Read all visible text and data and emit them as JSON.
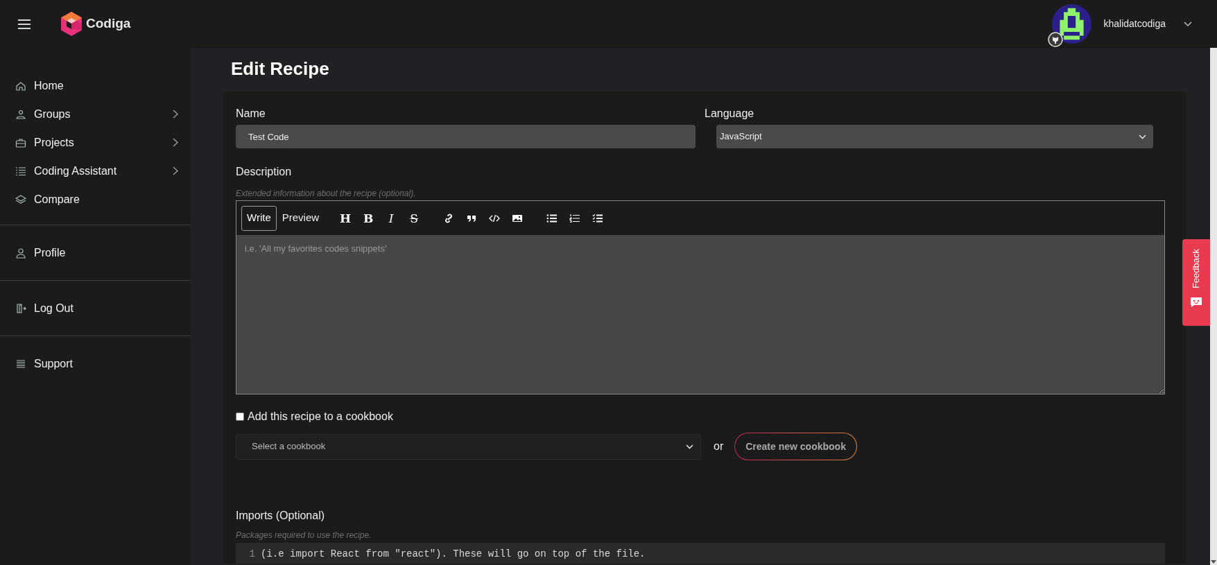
{
  "header": {
    "brand": "Codiga",
    "user": {
      "name": "khalidatcodiga"
    }
  },
  "sidebar": {
    "sections": [
      [
        {
          "label": "Home",
          "kind": "home",
          "submenu": false
        },
        {
          "label": "Groups",
          "kind": "groups",
          "submenu": true
        },
        {
          "label": "Projects",
          "kind": "briefcase",
          "submenu": true
        },
        {
          "label": "Coding Assistant",
          "kind": "list",
          "submenu": true
        },
        {
          "label": "Compare",
          "kind": "layers",
          "submenu": false
        }
      ],
      [
        {
          "label": "Profile",
          "kind": "user",
          "submenu": false
        }
      ],
      [
        {
          "label": "Log Out",
          "kind": "logout",
          "submenu": false
        }
      ],
      [
        {
          "label": "Support",
          "kind": "lines",
          "submenu": false
        }
      ]
    ]
  },
  "page": {
    "title": "Edit Recipe"
  },
  "form": {
    "name": {
      "label": "Name",
      "value": "Test Code"
    },
    "language": {
      "label": "Language",
      "value": "JavaScript"
    },
    "description": {
      "label": "Description",
      "hint": "Extended information about the recipe (optional).",
      "tabs": [
        {
          "label": "Write",
          "selected": true
        },
        {
          "label": "Preview",
          "selected": false
        }
      ],
      "toolbar": [
        [
          {
            "kind": "heading",
            "glyph": "H"
          },
          {
            "kind": "bold",
            "glyph": "B"
          },
          {
            "kind": "italic",
            "glyph": "I"
          },
          {
            "kind": "strike",
            "glyph": "S"
          }
        ],
        [
          {
            "kind": "link"
          },
          {
            "kind": "quote"
          },
          {
            "kind": "code"
          },
          {
            "kind": "image"
          }
        ],
        [
          {
            "kind": "bullets"
          },
          {
            "kind": "numbers"
          },
          {
            "kind": "tasks"
          }
        ]
      ],
      "placeholder": "i.e. 'All my favorites codes snippets'"
    },
    "cookbook": {
      "checkbox_label": "Add this recipe to a cookbook",
      "checked": false,
      "select_placeholder": "Select a cookbook",
      "or": "or",
      "create_button": "Create new cookbook"
    },
    "imports": {
      "label": "Imports (Optional)",
      "hint": "Packages required to use the recipe.",
      "line_number": "1",
      "placeholder": "(i.e import React from \"react\"). These will go on top of the file."
    }
  },
  "feedback": {
    "label": "Feedback"
  }
}
